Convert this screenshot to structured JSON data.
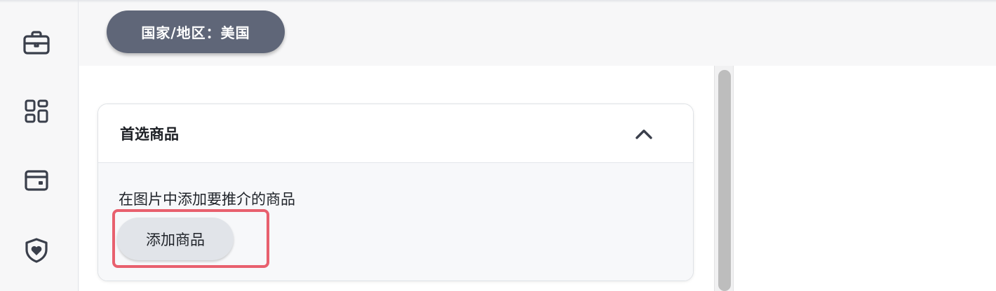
{
  "sidebar": {
    "items": [
      {
        "icon": "briefcase-icon"
      },
      {
        "icon": "dashboard-icon"
      },
      {
        "icon": "wallet-icon"
      },
      {
        "icon": "shield-heart-icon"
      }
    ]
  },
  "region": {
    "label": "国家/地区：美国"
  },
  "card": {
    "title": "首选商品",
    "collapse_icon": "chevron-up-icon",
    "description": "在图片中添加要推介的商品",
    "add_button_label": "添加商品"
  },
  "colors": {
    "pill": "#5f6678",
    "button": "#e1e4e9",
    "highlight": "#e8606e",
    "icon": "#3a3f4b"
  }
}
